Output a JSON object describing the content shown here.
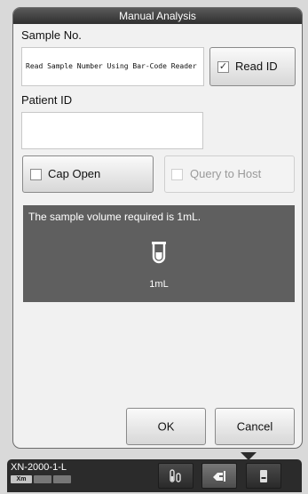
{
  "dialog": {
    "title": "Manual Analysis",
    "sample_no_label": "Sample No.",
    "sample_no_value": "Read Sample Number Using Bar-Code Reader",
    "read_id": {
      "label": "Read ID",
      "checked": true
    },
    "patient_id_label": "Patient ID",
    "patient_id_value": "",
    "cap_open": {
      "label": "Cap Open",
      "checked": false
    },
    "query_to_host": {
      "label": "Query to Host",
      "checked": false,
      "enabled": false
    },
    "info": {
      "message": "The sample volume required is 1mL.",
      "icon": "sample-tube-icon",
      "volume": "1mL"
    },
    "ok_label": "OK",
    "cancel_label": "Cancel"
  },
  "taskbar": {
    "device_name": "XN-2000-1-L",
    "device_badge": "Xm",
    "buttons": [
      {
        "icon": "sample-tubes-icon",
        "active": false
      },
      {
        "icon": "manual-analysis-icon",
        "active": true
      },
      {
        "icon": "analyzer-unit-icon",
        "active": false
      }
    ]
  },
  "colors": {
    "info_panel_bg": "#5f5f5f",
    "title_bar_bg": "#3c3c3c",
    "taskbar_bg": "#2b2b2b",
    "dialog_bg": "#f1f1f1"
  }
}
